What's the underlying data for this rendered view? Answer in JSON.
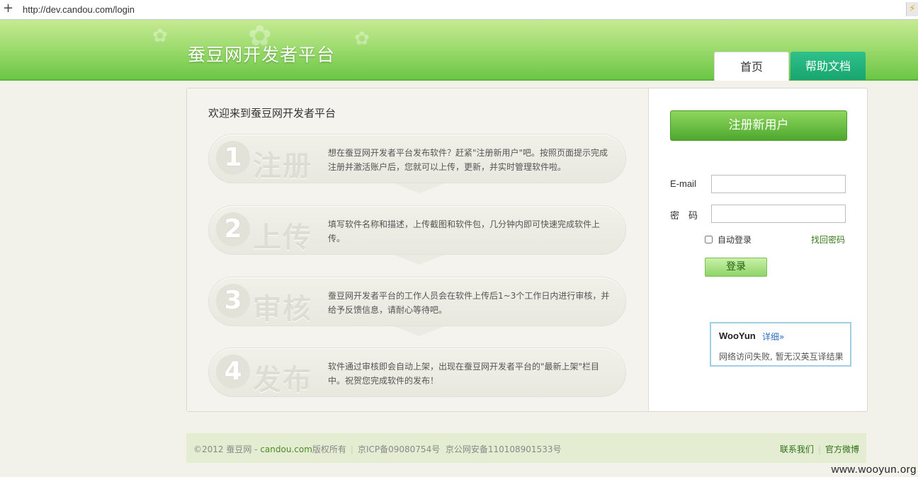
{
  "browser": {
    "url": "http://dev.candou.com/login"
  },
  "header": {
    "title": "蚕豆网开发者平台",
    "tabs": [
      {
        "label": "首页"
      },
      {
        "label": "帮助文档"
      }
    ]
  },
  "main": {
    "welcome": "欢迎来到蚕豆网开发者平台",
    "steps": [
      {
        "number": "1",
        "name": "注册",
        "desc": "想在蚕豆网开发者平台发布软件？赶紧\"注册新用户\"吧。按照页面提示完成注册并激活账户后，您就可以上传，更新，并实时管理软件啦。"
      },
      {
        "number": "2",
        "name": "上传",
        "desc": "填写软件名称和描述，上传截图和软件包，几分钟内即可快速完成软件上传。"
      },
      {
        "number": "3",
        "name": "审核",
        "desc": "蚕豆网开发者平台的工作人员会在软件上传后1~3个工作日内进行审核，并给予反馈信息，请耐心等待吧。"
      },
      {
        "number": "4",
        "name": "发布",
        "desc": "软件通过审核即会自动上架，出现在蚕豆网开发者平台的\"最新上架\"栏目中。祝贺您完成软件的发布！"
      }
    ]
  },
  "login": {
    "register_label": "注册新用户",
    "email_label": "E-mail",
    "email_value": "",
    "password_label": "密　码",
    "password_value": "",
    "auto_login_label": "自动登录",
    "forgot_label": "找回密码",
    "submit_label": "登录"
  },
  "wooyun": {
    "title": "WooYun",
    "detail_link": "详细»",
    "message": "网络访问失败, 暂无汉英互译结果"
  },
  "footer": {
    "copyright_prefix": "©2012 蚕豆网 - ",
    "domain": "candou.com",
    "copyright_suffix": "版权所有",
    "icp": "京ICP备09080754号",
    "police": "京公网安备110108901533号",
    "contact": "联系我们",
    "weibo": "官方微博"
  },
  "watermark": "www.wooyun.org",
  "colors": {
    "brand_green": "#6cc646",
    "help_tab": "#18a56f",
    "wooyun_border": "#9fcfe5"
  }
}
